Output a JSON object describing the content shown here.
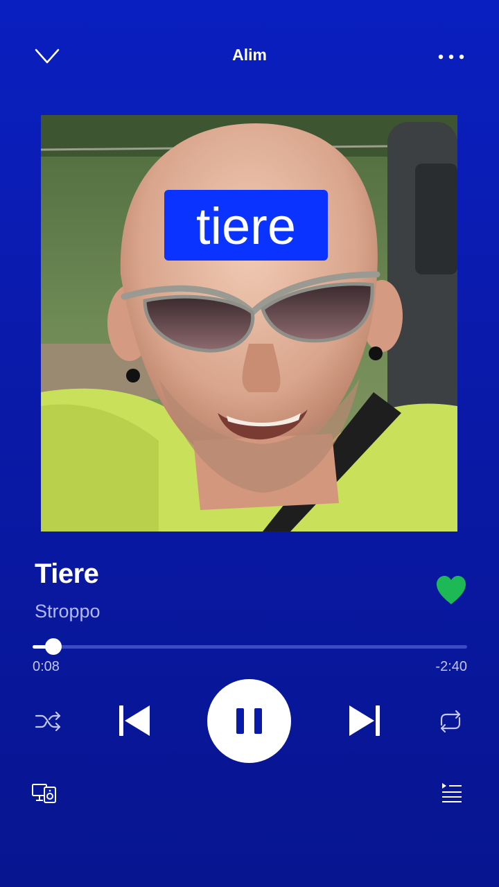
{
  "header": {
    "title": "Alim",
    "collapse_icon": "chevron-down-icon",
    "more_icon": "more-dots-icon"
  },
  "artwork": {
    "overlay_text": "tiere",
    "overlay_bg": "#0a33ff"
  },
  "track": {
    "title": "Tiere",
    "artist": "Stroppo",
    "liked": true,
    "like_color": "#1db954"
  },
  "progress": {
    "elapsed": "0:08",
    "remaining": "-2:40",
    "fraction": 0.048
  },
  "controls": {
    "shuffle_icon": "shuffle-icon",
    "previous_icon": "previous-track-icon",
    "play_pause_icon": "pause-icon",
    "next_icon": "next-track-icon",
    "repeat_icon": "repeat-icon"
  },
  "footer": {
    "devices_icon": "connect-devices-icon",
    "queue_icon": "queue-icon"
  },
  "colors": {
    "background_top": "#0a1fc0",
    "background_bottom": "#071590",
    "artist_text": "#b4b9f2",
    "progress_track": "#3d4ac6"
  }
}
